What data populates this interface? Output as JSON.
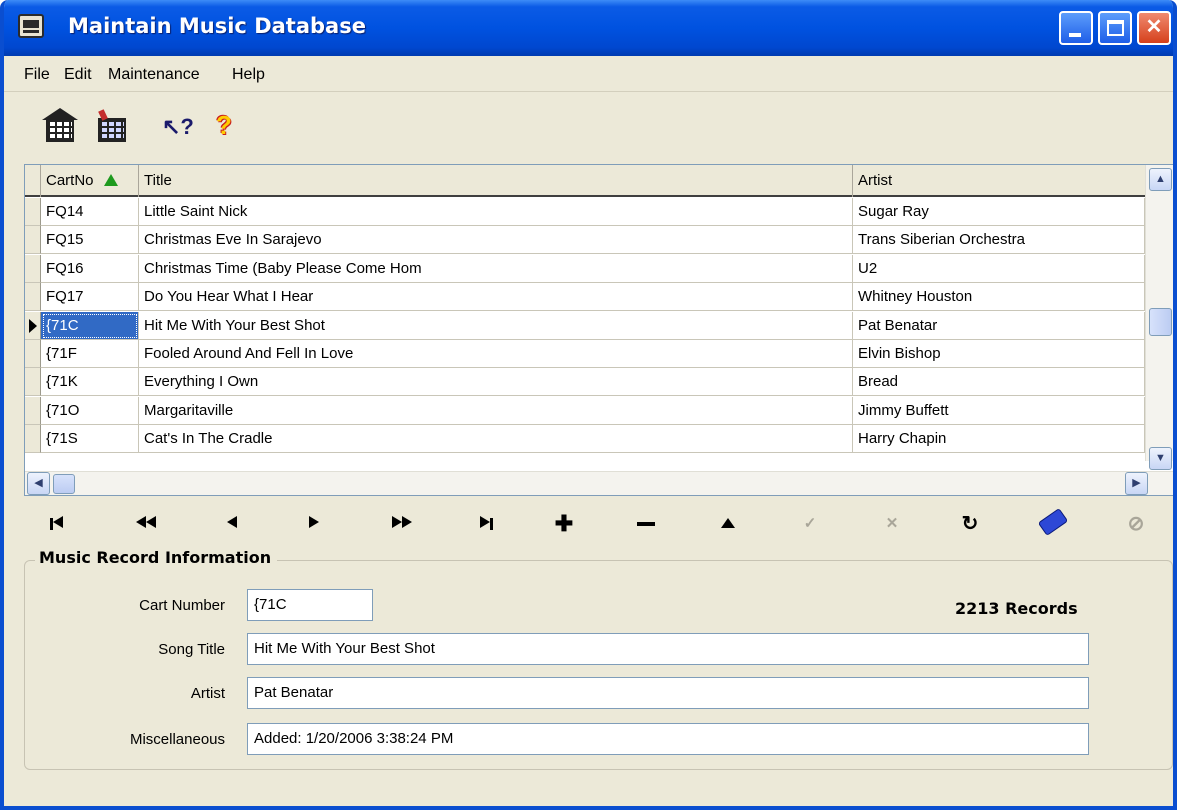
{
  "window": {
    "title": "Maintain Music Database"
  },
  "menu": [
    "File",
    "Edit",
    "Maintenance",
    "Help"
  ],
  "grid": {
    "columns": [
      "CartNo",
      "Title",
      "Artist"
    ],
    "rows": [
      {
        "cart": "FQ14",
        "title": "Little Saint Nick",
        "artist": "Sugar Ray"
      },
      {
        "cart": "FQ15",
        "title": "Christmas Eve In Sarajevo",
        "artist": "Trans Siberian Orchestra"
      },
      {
        "cart": "FQ16",
        "title": "Christmas Time (Baby Please Come Hom",
        "artist": "U2"
      },
      {
        "cart": "FQ17",
        "title": "Do You Hear What I Hear",
        "artist": "Whitney Houston"
      },
      {
        "cart": "{71C",
        "title": "Hit Me With Your Best Shot",
        "artist": "Pat Benatar"
      },
      {
        "cart": "{71F",
        "title": "Fooled Around And Fell In Love",
        "artist": "Elvin Bishop"
      },
      {
        "cart": "{71K",
        "title": "Everything I Own",
        "artist": "Bread"
      },
      {
        "cart": "{71O",
        "title": "Margaritaville",
        "artist": "Jimmy Buffett"
      },
      {
        "cart": "{71S",
        "title": "Cat's In The Cradle",
        "artist": "Harry Chapin"
      }
    ]
  },
  "record": {
    "legend": "Music Record Information",
    "cart_label": "Cart Number",
    "cart_value": "{71C",
    "title_label": "Song Title",
    "title_value": "Hit Me With Your Best Shot",
    "artist_label": "Artist",
    "artist_value": "Pat Benatar",
    "misc_label": "Miscellaneous",
    "misc_value": "Added: 1/20/2006 3:38:24 PM",
    "count": "2213 Records"
  },
  "colors": {
    "titlebar": "#0052e0",
    "selection": "#316ac5",
    "sort_arrow": "#1e9a1e",
    "window_bg": "#ece9d8"
  }
}
